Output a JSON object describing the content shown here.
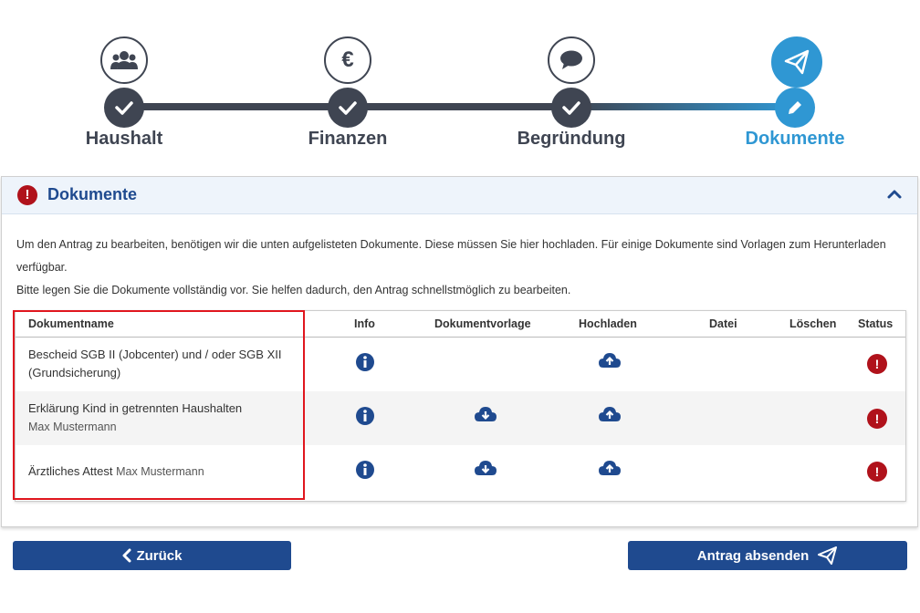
{
  "stepper": {
    "steps": [
      {
        "label": "Haushalt",
        "icon": "users-icon",
        "state": "done"
      },
      {
        "label": "Finanzen",
        "icon": "euro-icon",
        "state": "done"
      },
      {
        "label": "Begründung",
        "icon": "speech-bubble-icon",
        "state": "done"
      },
      {
        "label": "Dokumente",
        "icon": "paper-plane-icon",
        "state": "active"
      }
    ]
  },
  "panel": {
    "title": "Dokumente",
    "intro_line1": "Um den Antrag zu bearbeiten, benötigen wir die unten aufgelisteten Dokumente. Diese müssen Sie hier hochladen. Für einige Dokumente sind Vorlagen zum Herunterladen verfügbar.",
    "intro_line2": "Bitte legen Sie die Dokumente vollständig vor. Sie helfen dadurch, den Antrag schnellstmöglich zu bearbeiten."
  },
  "table": {
    "headers": {
      "name": "Dokumentname",
      "info": "Info",
      "template": "Dokumentvorlage",
      "upload": "Hochladen",
      "file": "Datei",
      "delete": "Löschen",
      "status": "Status"
    },
    "rows": [
      {
        "name": "Bescheid SGB II (Jobcenter) und / oder SGB XII (Grundsicherung)",
        "person": "",
        "has_template": false
      },
      {
        "name": "Erklärung Kind in getrennten Haushalten",
        "person": "Max Mustermann",
        "has_template": true
      },
      {
        "name": "Ärztliches Attest",
        "person": "Max Mustermann",
        "has_template": true
      }
    ]
  },
  "buttons": {
    "back": "Zurück",
    "submit": "Antrag absenden"
  },
  "colors": {
    "primary": "#1f4a8f",
    "accent": "#2f97d3",
    "dark": "#3f4552",
    "error": "#b0121b"
  }
}
